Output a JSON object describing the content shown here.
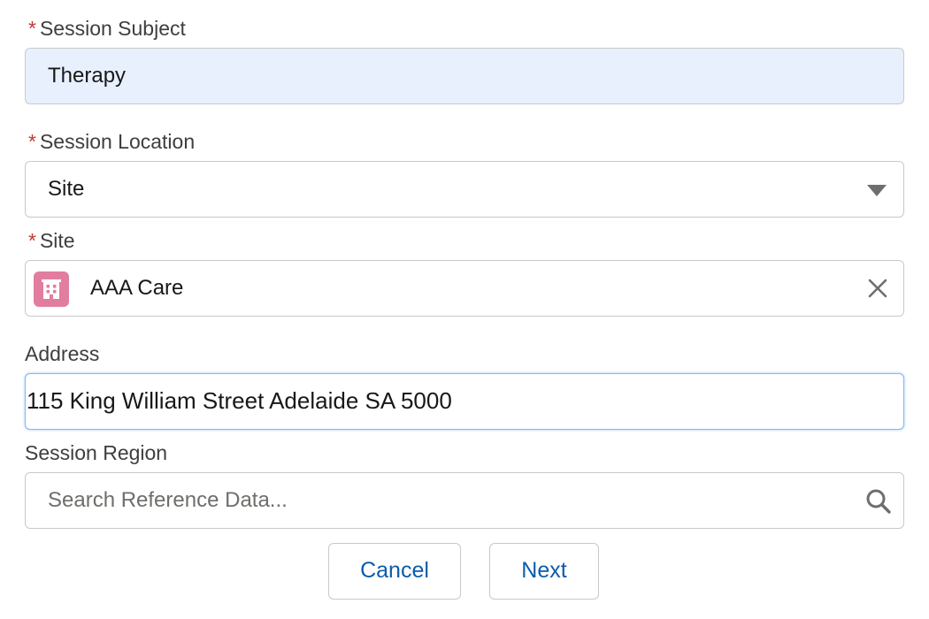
{
  "fields": {
    "subject": {
      "label": "Session Subject",
      "required_marker": "*",
      "value": "Therapy"
    },
    "location": {
      "label": "Session Location",
      "required_marker": "*",
      "value": "Site"
    },
    "site": {
      "label": "Site",
      "required_marker": "*",
      "value": "AAA Care",
      "icon": "building-icon",
      "clear_icon": "close-icon"
    },
    "address": {
      "label": "Address",
      "value": "115 King William Street Adelaide SA 5000"
    },
    "region": {
      "label": "Session Region",
      "value": "",
      "placeholder": "Search Reference Data...",
      "icon": "search-icon"
    }
  },
  "buttons": {
    "cancel": "Cancel",
    "next": "Next"
  },
  "colors": {
    "required": "#c23934",
    "subject_bg": "#e8f0fe",
    "site_icon_bg": "#e17ea0",
    "button_text": "#0b5cab",
    "focus_border": "#8fb3e8"
  }
}
